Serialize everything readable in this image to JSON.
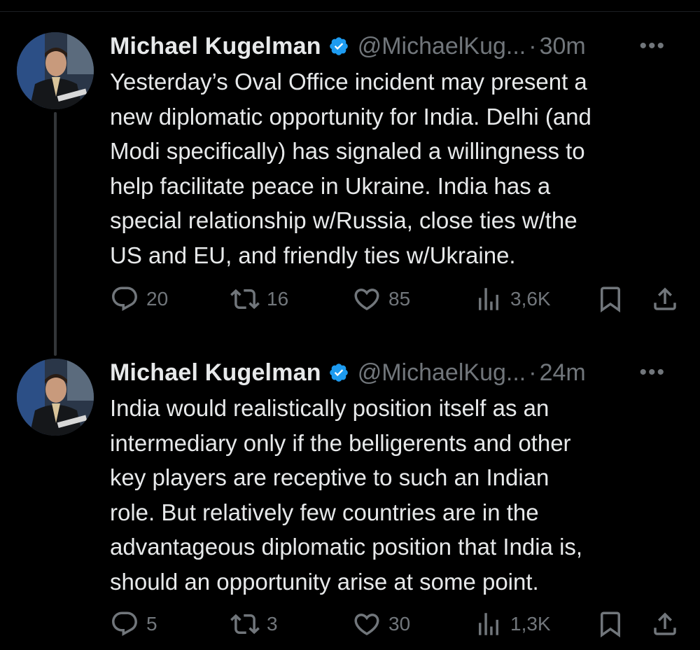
{
  "tweets": [
    {
      "author": "Michael Kugelman",
      "handle": "@MichaelKug...",
      "time": "30m",
      "text": "Yesterday’s Oval Office incident may present a\nnew diplomatic opportunity for India. Delhi (and\nModi specifically) has signaled a willingness to\nhelp facilitate peace in Ukraine. India has a\nspecial relationship w/Russia, close ties w/the\nUS and EU, and friendly ties w/Ukraine.",
      "replies": "20",
      "reposts": "16",
      "likes": "85",
      "views": "3,6K"
    },
    {
      "author": "Michael Kugelman",
      "handle": "@MichaelKug...",
      "time": "24m",
      "text": "India would realistically position itself as an\nintermediary only if the belligerents and other\nkey players are receptive to such an Indian\nrole. But relatively few countries are in the\nadvantageous diplomatic position that India is,\nshould an opportunity arise at some point.",
      "replies": "5",
      "reposts": "3",
      "likes": "30",
      "views": "1,3K"
    }
  ],
  "ui": {
    "dot_separator": "·",
    "more_glyph": "•••"
  },
  "colors": {
    "background": "#000000",
    "text": "#e7e9ea",
    "muted": "#71767b",
    "verified": "#1d9bf0"
  }
}
